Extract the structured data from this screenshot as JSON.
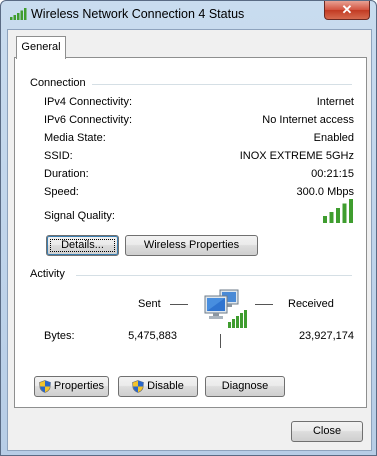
{
  "window": {
    "title": "Wireless Network Connection 4 Status",
    "close_glyph": "✕"
  },
  "tabs": [
    {
      "label": "General"
    }
  ],
  "connection": {
    "group_label": "Connection",
    "rows": [
      {
        "label": "IPv4 Connectivity:",
        "value": "Internet"
      },
      {
        "label": "IPv6 Connectivity:",
        "value": "No Internet access"
      },
      {
        "label": "Media State:",
        "value": "Enabled"
      },
      {
        "label": "SSID:",
        "value": "INOX EXTREME 5GHz"
      },
      {
        "label": "Duration:",
        "value": "00:21:15"
      },
      {
        "label": "Speed:",
        "value": "300.0 Mbps"
      }
    ],
    "signal_label": "Signal Quality:",
    "signal_bars_filled": 5,
    "signal_bars_total": 5
  },
  "buttons": {
    "details": "Details...",
    "wireless_properties": "Wireless Properties",
    "properties": "Properties",
    "disable": "Disable",
    "diagnose": "Diagnose",
    "close": "Close"
  },
  "activity": {
    "group_label": "Activity",
    "sent_label": "Sent",
    "received_label": "Received",
    "bytes_label": "Bytes:",
    "bytes_sent": "5,475,883",
    "bytes_received": "23,927,174"
  },
  "colors": {
    "signal_green": "#3f9d2f",
    "accent_blue": "#3c7fb1"
  }
}
